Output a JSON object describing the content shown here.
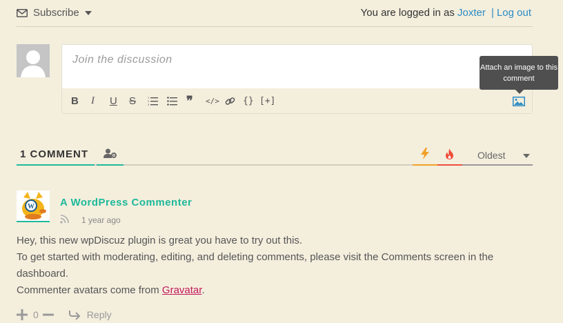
{
  "topbar": {
    "subscribe_label": "Subscribe",
    "logged_in_prefix": "You are logged in as",
    "username": "Joxter",
    "separator": "|",
    "logout_label": "Log out"
  },
  "form": {
    "placeholder": "Join the discussion",
    "tooltip": "Attach an image to this comment",
    "toolbar": [
      {
        "name": "bold-icon",
        "glyph": "B"
      },
      {
        "name": "italic-icon",
        "glyph": "I"
      },
      {
        "name": "underline-icon",
        "glyph": "U"
      },
      {
        "name": "strikethrough-icon",
        "glyph": "S"
      },
      {
        "name": "ordered-list-icon",
        "glyph": ""
      },
      {
        "name": "unordered-list-icon",
        "glyph": ""
      },
      {
        "name": "blockquote-icon",
        "glyph": "❞"
      },
      {
        "name": "code-icon",
        "glyph": "</>"
      },
      {
        "name": "link-icon",
        "glyph": ""
      },
      {
        "name": "source-code-icon",
        "glyph": "{}"
      },
      {
        "name": "spoiler-icon",
        "glyph": "[+]"
      }
    ]
  },
  "comments_header": {
    "count_label": "1 COMMENT",
    "sort_label": "Oldest"
  },
  "comment": {
    "author": "A WordPress Commenter",
    "time": "1 year ago",
    "line1": "Hey, this new wpDiscuz plugin is great you have to try out this.",
    "line2": "To get started with moderating, editing, and deleting comments, please visit the Comments screen in the dashboard.",
    "line3_prefix": "Commenter avatars come from ",
    "line3_link": "Gravatar",
    "line3_suffix": ".",
    "vote_count": "0",
    "reply_label": "Reply"
  },
  "colors": {
    "background": "#f4eedd",
    "accent": "#1db99a",
    "link": "#2b8cc4",
    "hot": "#f0a026",
    "trending": "#ef4e3a",
    "tooltip_bg": "#4f4f4f"
  }
}
